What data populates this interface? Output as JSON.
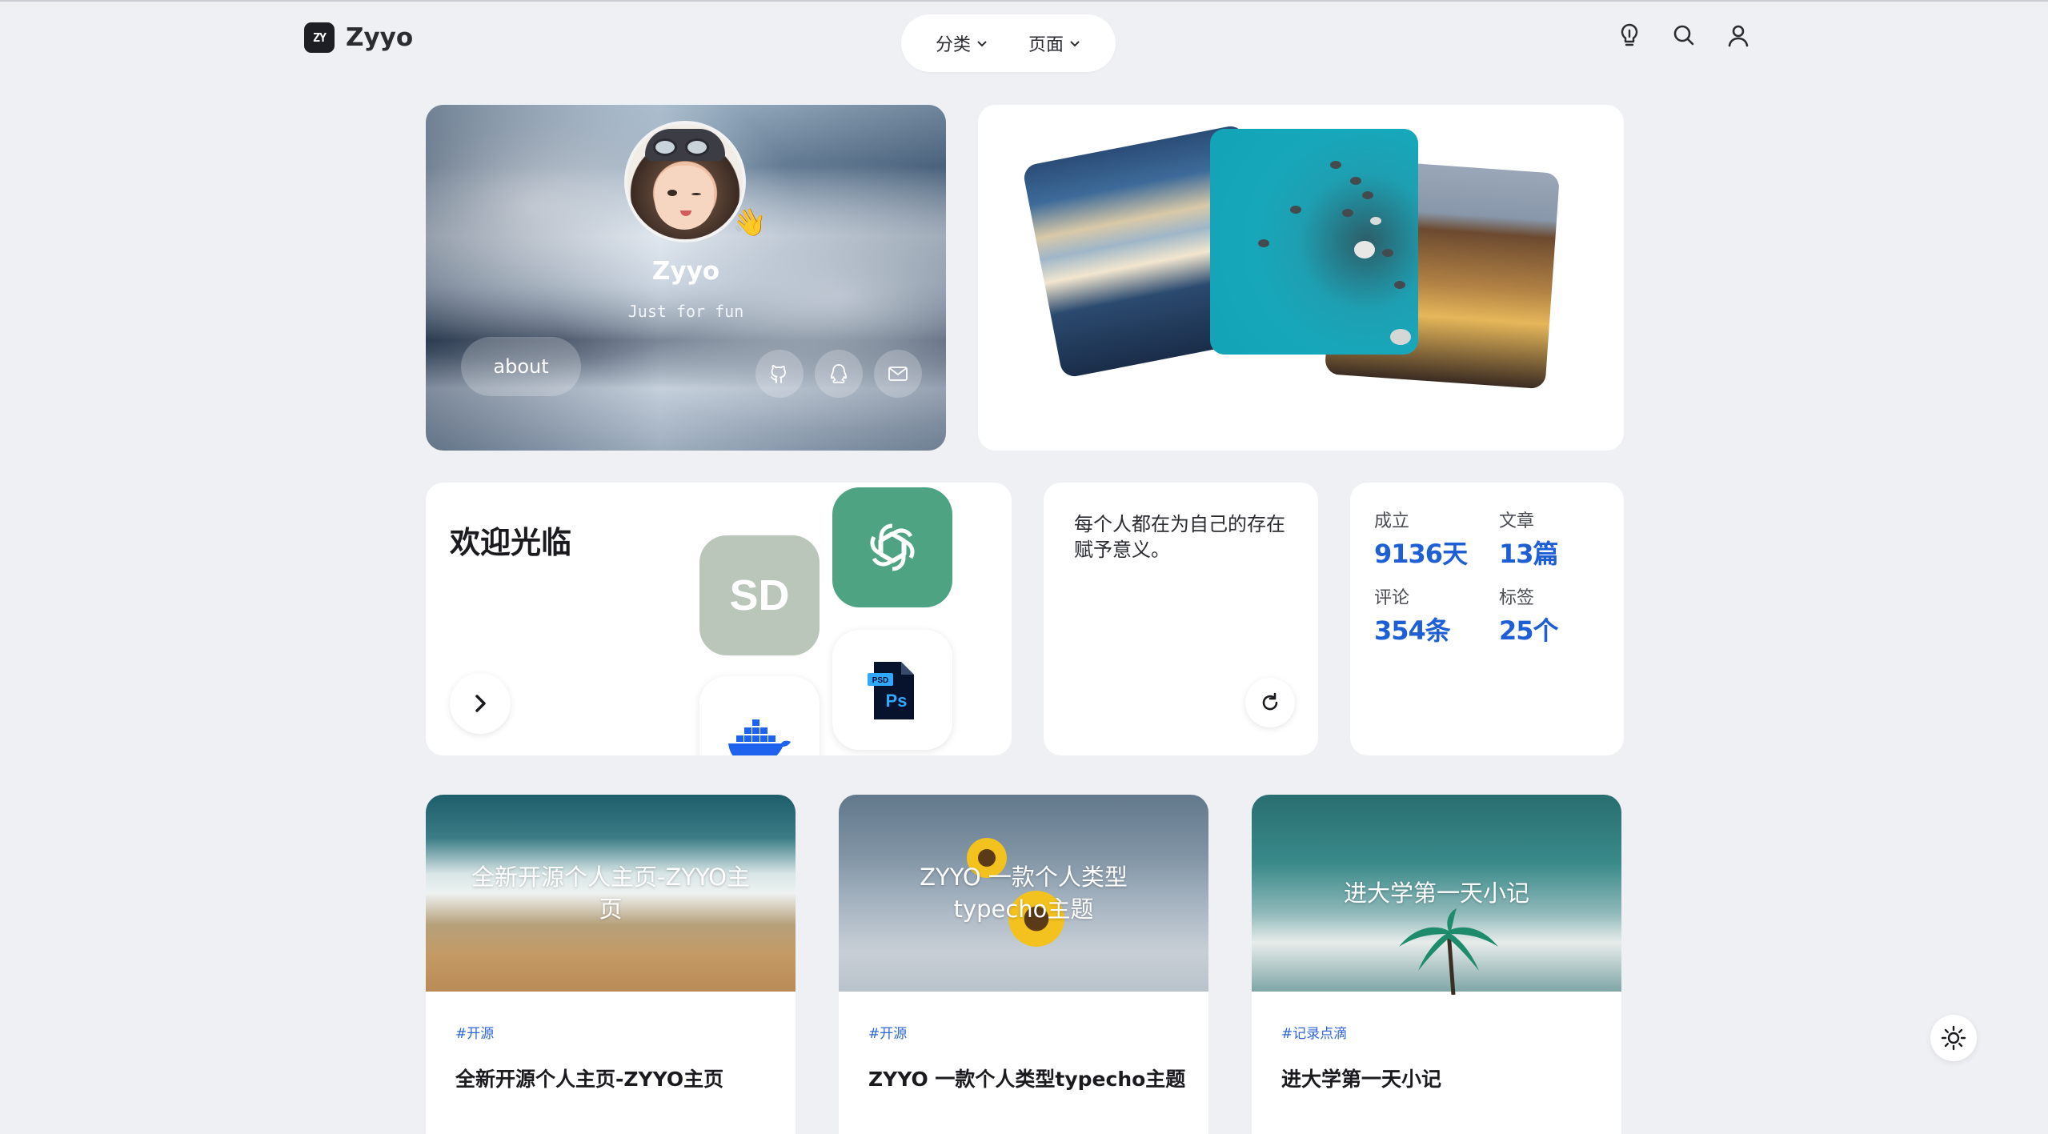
{
  "header": {
    "logo_mark": "ZY",
    "site_name": "Zyyo",
    "nav": [
      {
        "label": "分类"
      },
      {
        "label": "页面"
      }
    ],
    "icons": [
      "bulb-icon",
      "search-icon",
      "user-icon"
    ]
  },
  "profile": {
    "name": "Zyyo",
    "tagline": "Just for fun",
    "wave_emoji": "👋",
    "about_label": "about",
    "social": [
      "github-icon",
      "qq-icon",
      "mail-icon"
    ]
  },
  "welcome": {
    "title": "欢迎光临",
    "sd_label": "SD",
    "ps_badge": "PSD",
    "ps_label": "Ps"
  },
  "quote": {
    "text": "每个人都在为自己的存在赋予意义。"
  },
  "stats": [
    {
      "label": "成立",
      "value": "9136天"
    },
    {
      "label": "文章",
      "value": "13篇"
    },
    {
      "label": "评论",
      "value": "354条"
    },
    {
      "label": "标签",
      "value": "25个"
    }
  ],
  "posts": [
    {
      "cover_title": "全新开源个人主页-ZYYO主页",
      "tag": "#开源",
      "title": "全新开源个人主页-ZYYO主页"
    },
    {
      "cover_title": "ZYYO 一款个人类型typecho主题",
      "tag": "#开源",
      "title": "ZYYO 一款个人类型typecho主题"
    },
    {
      "cover_title": "进大学第一天小记",
      "tag": "#记录点滴",
      "title": "进大学第一天小记"
    }
  ],
  "colors": {
    "background": "#eef0f4",
    "accent_blue": "#1f5fd6",
    "tag_blue": "#2f67d6",
    "gpt_green": "#4da382"
  }
}
